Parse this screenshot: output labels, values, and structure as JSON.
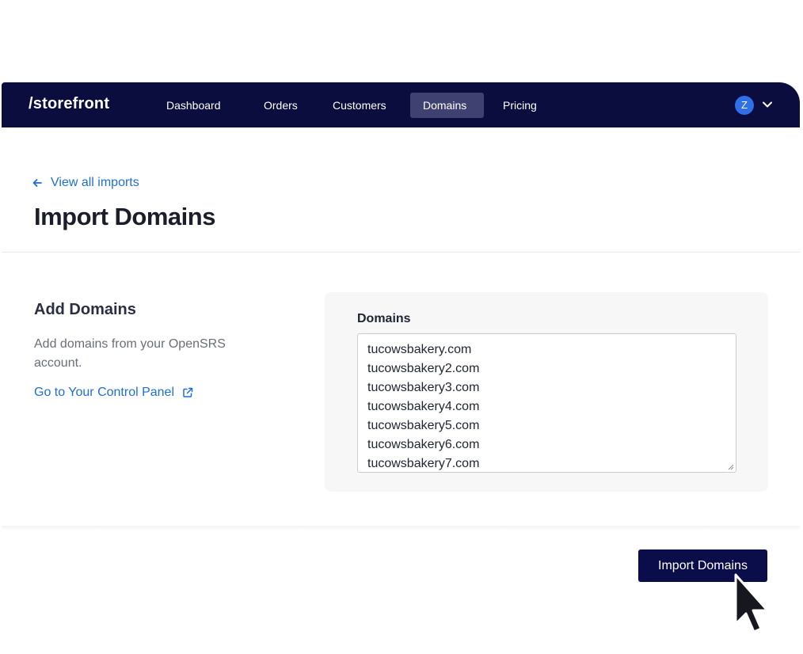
{
  "nav": {
    "logo": "/storefront",
    "items": [
      {
        "label": "Dashboard",
        "active": false
      },
      {
        "label": "Orders",
        "active": false
      },
      {
        "label": "Customers",
        "active": false
      },
      {
        "label": "Domains",
        "active": true
      },
      {
        "label": "Pricing",
        "active": false
      }
    ],
    "avatar_initial": "Z",
    "avatar_icon": "chevron-down-icon"
  },
  "header": {
    "back_link": "View all imports",
    "back_icon": "arrow-left-icon",
    "title": "Import Domains"
  },
  "section": {
    "title": "Add Domains",
    "description": "Add domains from your OpenSRS account.",
    "control_panel_link": "Go to Your Control Panel",
    "external_icon": "external-link-icon"
  },
  "form": {
    "label": "Domains",
    "domains": [
      "tucowsbakery.com",
      "tucowsbakery2.com",
      "tucowsbakery3.com",
      "tucowsbakery4.com",
      "tucowsbakery5.com",
      "tucowsbakery6.com",
      "tucowsbakery7.com"
    ]
  },
  "footer": {
    "import_button": "Import Domains"
  },
  "colors": {
    "nav_bg": "#0b0d3f",
    "nav_active": "#3f4170",
    "link": "#1f6fd6",
    "button_bg": "#0b0d4a",
    "avatar": "#2f6fe8"
  }
}
